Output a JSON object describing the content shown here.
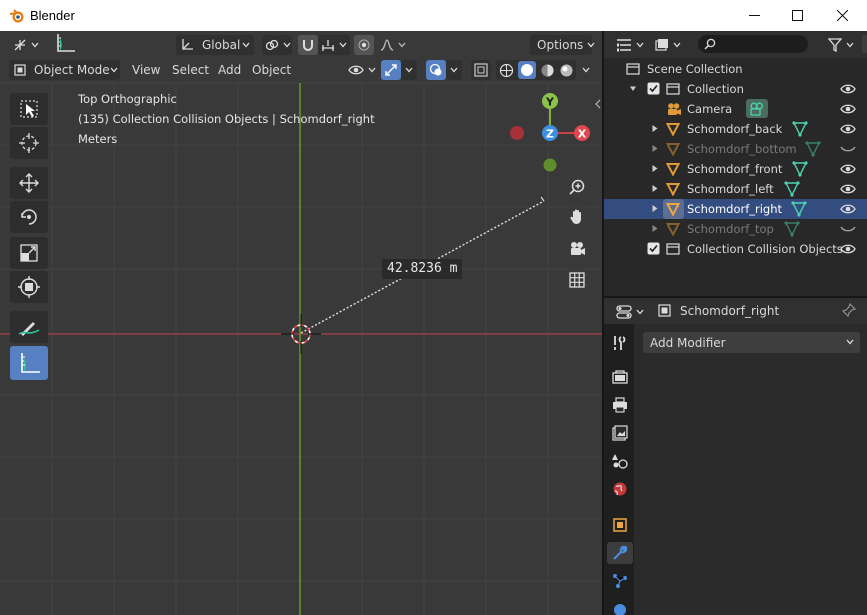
{
  "window": {
    "title": "Blender",
    "controls": [
      "minimize",
      "maximize",
      "close"
    ]
  },
  "viewport": {
    "header": {
      "orientation": "Global",
      "options_label": "Options",
      "mode": "Object Mode",
      "menus": [
        "View",
        "Select",
        "Add",
        "Object"
      ]
    },
    "info": {
      "line1": "Top Orthographic",
      "line2": "(135) Collection Collision Objects | Schomdorf_right",
      "line3": "Meters"
    },
    "gizmo": {
      "y": "Y",
      "z": "Z",
      "x": "X"
    },
    "measurement": "42.8236 m",
    "tools": [
      "select-box",
      "cursor",
      "move",
      "rotate",
      "scale",
      "transform",
      "annotate",
      "measure"
    ],
    "active_tool": "measure",
    "colors": {
      "background": "#393939",
      "x_axis": "#c8424a",
      "y_axis": "#6a9a24",
      "active": "#5680c2"
    }
  },
  "outliner": {
    "search_placeholder": "",
    "rows": [
      {
        "label": "Scene Collection",
        "type": "scene",
        "dim": false,
        "selected": false
      },
      {
        "label": "Collection",
        "type": "collection",
        "dim": false,
        "selected": false
      },
      {
        "label": "Camera",
        "type": "camera",
        "dim": false,
        "selected": false
      },
      {
        "label": "Schomdorf_back",
        "type": "mesh",
        "dim": false,
        "selected": false
      },
      {
        "label": "Schomdorf_bottom",
        "type": "mesh",
        "dim": true,
        "selected": false
      },
      {
        "label": "Schomdorf_front",
        "type": "mesh",
        "dim": false,
        "selected": false
      },
      {
        "label": "Schomdorf_left",
        "type": "mesh",
        "dim": false,
        "selected": false
      },
      {
        "label": "Schomdorf_right",
        "type": "mesh",
        "dim": false,
        "selected": true
      },
      {
        "label": "Schomdorf_top",
        "type": "mesh",
        "dim": true,
        "selected": false
      },
      {
        "label": "Collection Collision Objects",
        "type": "collection",
        "dim": false,
        "selected": false
      }
    ]
  },
  "properties": {
    "object_name": "Schomdorf_right",
    "add_modifier_label": "Add Modifier",
    "tabs": [
      "tool",
      "render",
      "output",
      "view-layer",
      "scene",
      "world",
      "object",
      "modifiers",
      "particles",
      "physics"
    ],
    "active_tab": "modifiers"
  }
}
